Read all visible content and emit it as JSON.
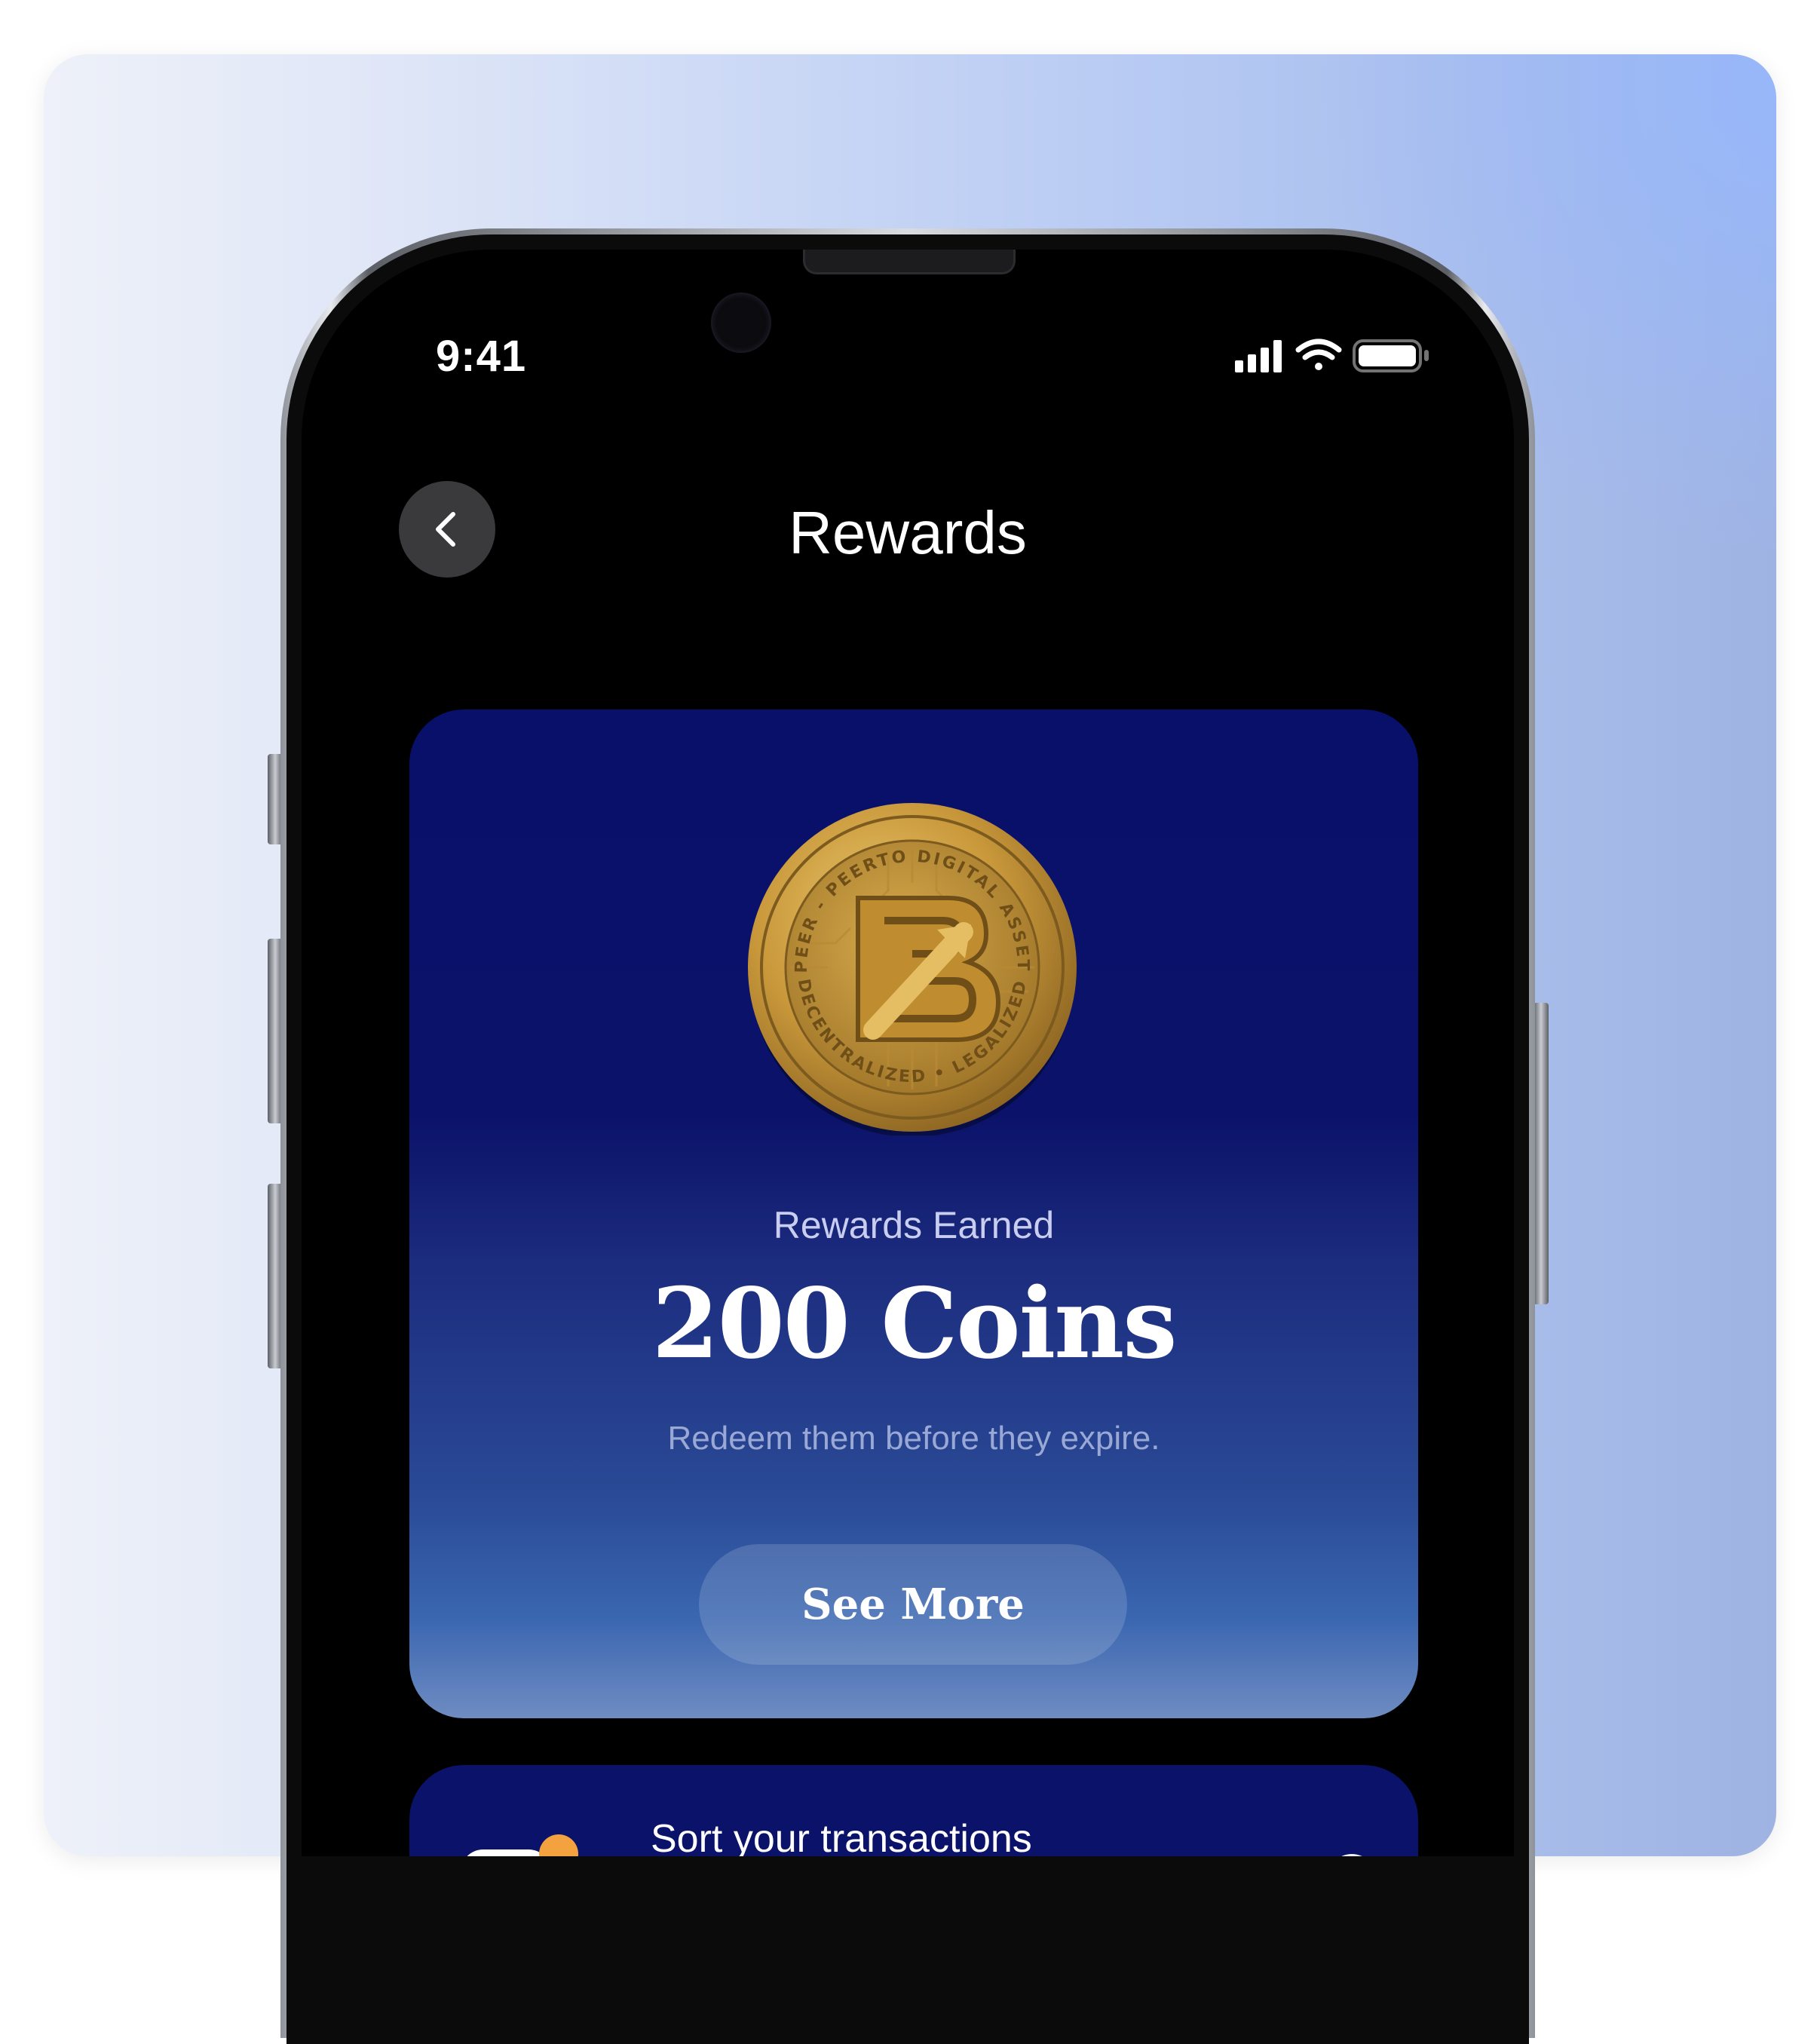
{
  "status_bar": {
    "time": "9:41",
    "icons": [
      "cellular-signal-icon",
      "wifi-icon",
      "battery-icon"
    ]
  },
  "header": {
    "title": "Rewards",
    "back_icon": "chevron-left-icon"
  },
  "rewards_card": {
    "coin_icon": "coin-icon",
    "coin_text_top": "PEER - PEERTO DIGITAL ASSET",
    "coin_text_bottom": "DECENTRALIZED • LEGALIZED",
    "label": "Rewards Earned",
    "value": "200 Coins",
    "subtitle": "Redeem them before they expire.",
    "button_label": "See More"
  },
  "second_card": {
    "title": "Sort your transactions"
  },
  "colors": {
    "card_top": "#08106a",
    "card_bottom": "#6f8cc2",
    "coin_gold": "#c8973a",
    "accent_orange": "#f4a240"
  }
}
